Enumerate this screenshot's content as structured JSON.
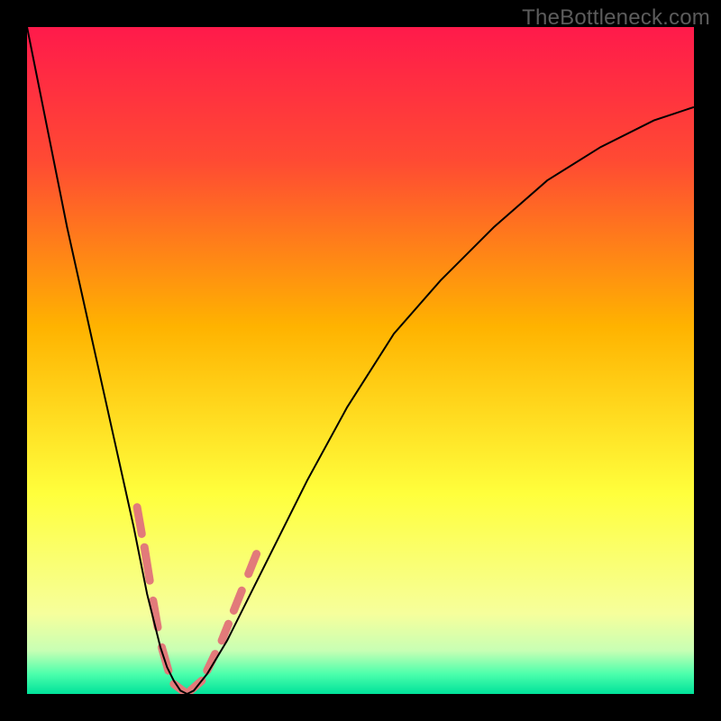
{
  "watermark": "TheBottleneck.com",
  "chart_data": {
    "type": "line",
    "title": "",
    "xlabel": "",
    "ylabel": "",
    "xlim": [
      0,
      100
    ],
    "ylim": [
      0,
      100
    ],
    "background_gradient": {
      "stops": [
        {
          "offset": 0.0,
          "color": "#ff1a4b"
        },
        {
          "offset": 0.2,
          "color": "#ff4a33"
        },
        {
          "offset": 0.45,
          "color": "#ffb300"
        },
        {
          "offset": 0.7,
          "color": "#ffff3c"
        },
        {
          "offset": 0.88,
          "color": "#f6ff9c"
        },
        {
          "offset": 0.935,
          "color": "#c8ffb4"
        },
        {
          "offset": 0.97,
          "color": "#4cffac"
        },
        {
          "offset": 1.0,
          "color": "#00e29a"
        }
      ]
    },
    "series": [
      {
        "name": "curve",
        "color": "#000000",
        "x": [
          0,
          2,
          4,
          6,
          8,
          10,
          12,
          14,
          16,
          17,
          18,
          19,
          20,
          21,
          22,
          23,
          24,
          25,
          27,
          30,
          34,
          38,
          42,
          48,
          55,
          62,
          70,
          78,
          86,
          94,
          100
        ],
        "y": [
          100,
          90,
          80,
          70,
          61,
          52,
          43,
          34,
          25,
          20,
          15,
          11,
          7,
          4,
          2,
          0.5,
          0,
          0.5,
          3,
          8,
          16,
          24,
          32,
          43,
          54,
          62,
          70,
          77,
          82,
          86,
          88
        ]
      }
    ],
    "markers": {
      "name": "dash-markers",
      "color": "#e27a7a",
      "stroke_width": 9,
      "segments": [
        {
          "x1": 16.5,
          "y1": 28,
          "x2": 17.2,
          "y2": 24
        },
        {
          "x1": 17.6,
          "y1": 22,
          "x2": 18.4,
          "y2": 17
        },
        {
          "x1": 18.9,
          "y1": 14,
          "x2": 19.6,
          "y2": 10
        },
        {
          "x1": 20.2,
          "y1": 7,
          "x2": 21.2,
          "y2": 3.5
        },
        {
          "x1": 22.0,
          "y1": 1.5,
          "x2": 23.6,
          "y2": 0.3
        },
        {
          "x1": 24.5,
          "y1": 0.5,
          "x2": 26.2,
          "y2": 2.0
        },
        {
          "x1": 27.0,
          "y1": 3.5,
          "x2": 28.2,
          "y2": 6.0
        },
        {
          "x1": 29.2,
          "y1": 8.0,
          "x2": 30.2,
          "y2": 10.5
        },
        {
          "x1": 31.0,
          "y1": 12.5,
          "x2": 32.2,
          "y2": 15.5
        },
        {
          "x1": 33.2,
          "y1": 18.0,
          "x2": 34.4,
          "y2": 21.0
        }
      ]
    }
  }
}
